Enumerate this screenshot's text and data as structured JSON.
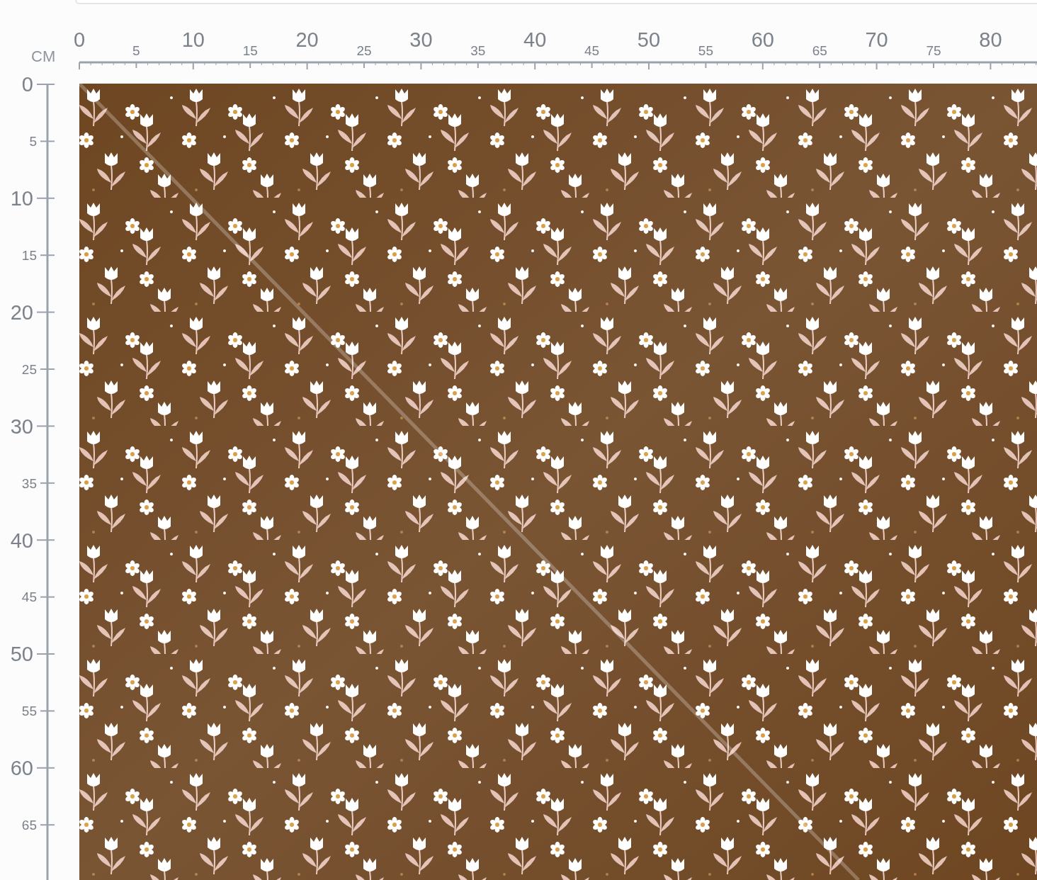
{
  "ruler": {
    "unit": "CM",
    "horizontal": [
      {
        "label": "0",
        "kind": "major"
      },
      {
        "label": "5",
        "kind": "minor"
      },
      {
        "label": "10",
        "kind": "major"
      },
      {
        "label": "15",
        "kind": "minor"
      },
      {
        "label": "20",
        "kind": "major"
      },
      {
        "label": "25",
        "kind": "minor"
      },
      {
        "label": "30",
        "kind": "major"
      },
      {
        "label": "35",
        "kind": "minor"
      },
      {
        "label": "40",
        "kind": "major"
      },
      {
        "label": "45",
        "kind": "minor"
      },
      {
        "label": "50",
        "kind": "major"
      },
      {
        "label": "55",
        "kind": "minor"
      },
      {
        "label": "60",
        "kind": "major"
      },
      {
        "label": "65",
        "kind": "minor"
      },
      {
        "label": "70",
        "kind": "major"
      },
      {
        "label": "75",
        "kind": "minor"
      },
      {
        "label": "80",
        "kind": "major"
      }
    ],
    "vertical": [
      {
        "label": "0",
        "kind": "major"
      },
      {
        "label": "5",
        "kind": "minor"
      },
      {
        "label": "10",
        "kind": "major"
      },
      {
        "label": "15",
        "kind": "minor"
      },
      {
        "label": "20",
        "kind": "major"
      },
      {
        "label": "25",
        "kind": "minor"
      },
      {
        "label": "30",
        "kind": "major"
      },
      {
        "label": "35",
        "kind": "minor"
      },
      {
        "label": "40",
        "kind": "major"
      },
      {
        "label": "45",
        "kind": "minor"
      },
      {
        "label": "50",
        "kind": "major"
      },
      {
        "label": "55",
        "kind": "minor"
      },
      {
        "label": "60",
        "kind": "major"
      },
      {
        "label": "65",
        "kind": "minor"
      }
    ]
  }
}
